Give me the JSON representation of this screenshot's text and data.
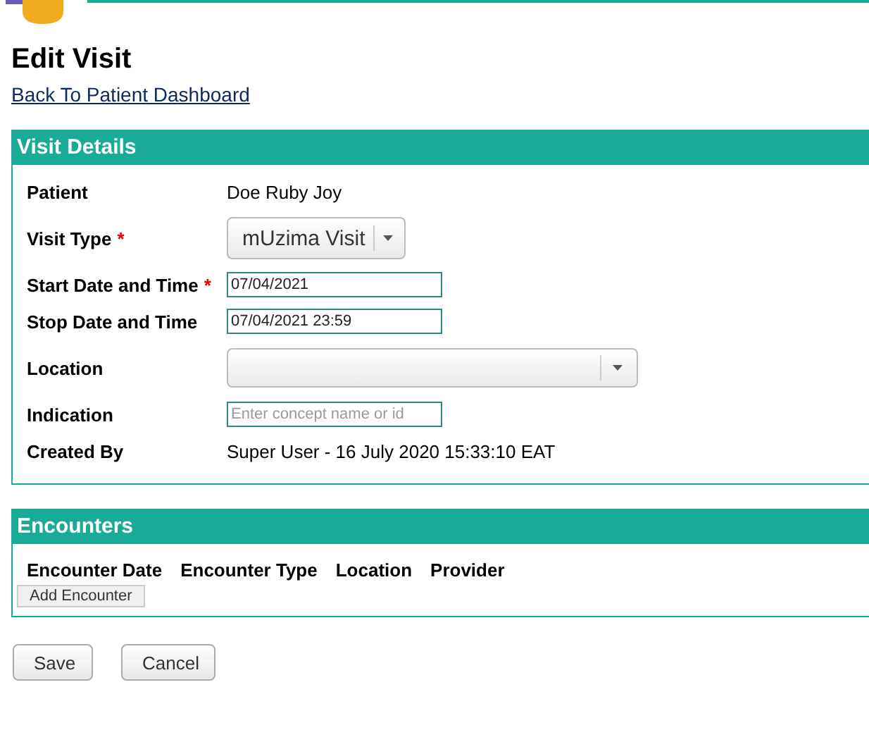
{
  "title": "Edit Visit",
  "back_link": "Back To Patient Dashboard",
  "visit_details": {
    "heading": "Visit Details",
    "fields": [
      {
        "label": "Patient",
        "kind": "text",
        "value": "Doe Ruby Joy"
      },
      {
        "label": "Visit Type",
        "required_mark": "*",
        "kind": "select",
        "value": "mUzima Visit"
      },
      {
        "label": "Start Date and Time",
        "required_mark": "*",
        "kind": "input",
        "value": "07/04/2021"
      },
      {
        "label": "Stop Date and Time",
        "kind": "input",
        "value": "07/04/2021 23:59"
      },
      {
        "label": "Location",
        "kind": "wide-select"
      },
      {
        "label": "Indication",
        "kind": "input",
        "placeholder": "Enter concept name or id"
      },
      {
        "label": "Created By",
        "kind": "text",
        "value": "Super User - 16 July 2020 15:33:10 EAT"
      }
    ]
  },
  "encounters": {
    "heading": "Encounters",
    "columns": [
      "Encounter Date",
      "Encounter Type",
      "Location",
      "Provider"
    ],
    "add_button": "Add Encounter"
  },
  "buttons": [
    "Save",
    "Cancel"
  ]
}
